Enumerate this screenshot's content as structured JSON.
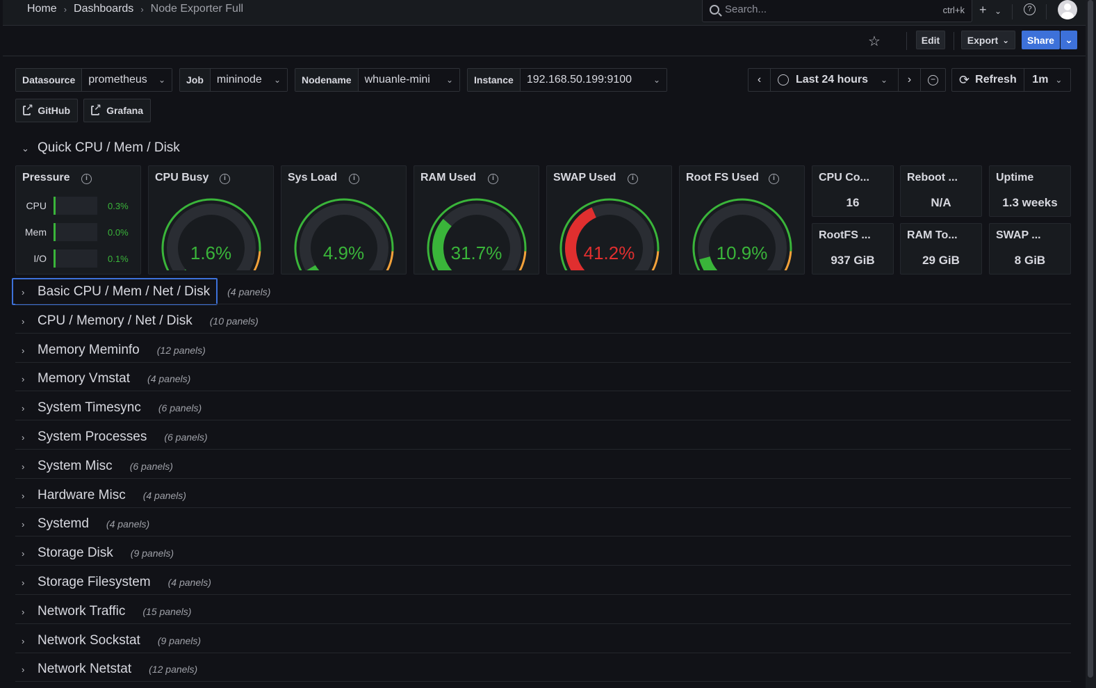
{
  "breadcrumb": [
    "Home",
    "Dashboards",
    "Node Exporter Full"
  ],
  "search": {
    "placeholder": "Search...",
    "shortcut": "ctrl+k"
  },
  "toolbar": {
    "edit": "Edit",
    "export": "Export",
    "share": "Share"
  },
  "variables": [
    {
      "label": "Datasource",
      "value": "prometheus"
    },
    {
      "label": "Job",
      "value": "mininode"
    },
    {
      "label": "Nodename",
      "value": "whuanle-mini"
    },
    {
      "label": "Instance",
      "value": "192.168.50.199:9100"
    }
  ],
  "timepicker": {
    "range": "Last 24 hours",
    "refresh": "Refresh",
    "interval": "1m"
  },
  "links": [
    "GitHub",
    "Grafana"
  ],
  "quick_section": {
    "title": "Quick CPU / Mem / Disk"
  },
  "pressure": {
    "title": "Pressure",
    "rows": [
      {
        "label": "CPU",
        "value": "0.3%",
        "fraction": 0.003
      },
      {
        "label": "Mem",
        "value": "0.0%",
        "fraction": 0.0
      },
      {
        "label": "I/O",
        "value": "0.1%",
        "fraction": 0.001
      }
    ]
  },
  "gauges": [
    {
      "title": "CPU Busy",
      "value": "1.6%",
      "percent": 1.6,
      "color": "#3ab53a"
    },
    {
      "title": "Sys Load",
      "value": "4.9%",
      "percent": 4.9,
      "color": "#3ab53a"
    },
    {
      "title": "RAM Used",
      "value": "31.7%",
      "percent": 31.7,
      "color": "#3ab53a"
    },
    {
      "title": "SWAP Used",
      "value": "41.2%",
      "percent": 41.2,
      "color": "#e02f2f"
    },
    {
      "title": "Root FS Used",
      "value": "10.9%",
      "percent": 10.9,
      "color": "#3ab53a"
    }
  ],
  "stats": [
    {
      "title": "CPU Co...",
      "value": "16"
    },
    {
      "title": "Reboot ...",
      "value": "N/A"
    },
    {
      "title": "Uptime",
      "value": "1.3 weeks"
    },
    {
      "title": "RootFS ...",
      "value": "937 GiB"
    },
    {
      "title": "RAM To...",
      "value": "29 GiB"
    },
    {
      "title": "SWAP ...",
      "value": "8 GiB"
    }
  ],
  "rows": [
    {
      "title": "Basic CPU / Mem / Net / Disk",
      "count": "(4 panels)"
    },
    {
      "title": "CPU / Memory / Net / Disk",
      "count": "(10 panels)"
    },
    {
      "title": "Memory Meminfo",
      "count": "(12 panels)"
    },
    {
      "title": "Memory Vmstat",
      "count": "(4 panels)"
    },
    {
      "title": "System Timesync",
      "count": "(6 panels)"
    },
    {
      "title": "System Processes",
      "count": "(6 panels)"
    },
    {
      "title": "System Misc",
      "count": "(6 panels)"
    },
    {
      "title": "Hardware Misc",
      "count": "(4 panels)"
    },
    {
      "title": "Systemd",
      "count": "(4 panels)"
    },
    {
      "title": "Storage Disk",
      "count": "(9 panels)"
    },
    {
      "title": "Storage Filesystem",
      "count": "(4 panels)"
    },
    {
      "title": "Network Traffic",
      "count": "(15 panels)"
    },
    {
      "title": "Network Sockstat",
      "count": "(9 panels)"
    },
    {
      "title": "Network Netstat",
      "count": "(12 panels)"
    }
  ],
  "colors": {
    "ok": "#3ab53a",
    "bad": "#e02f2f",
    "warn": "#f2a13a",
    "accent": "#3d71d9"
  }
}
